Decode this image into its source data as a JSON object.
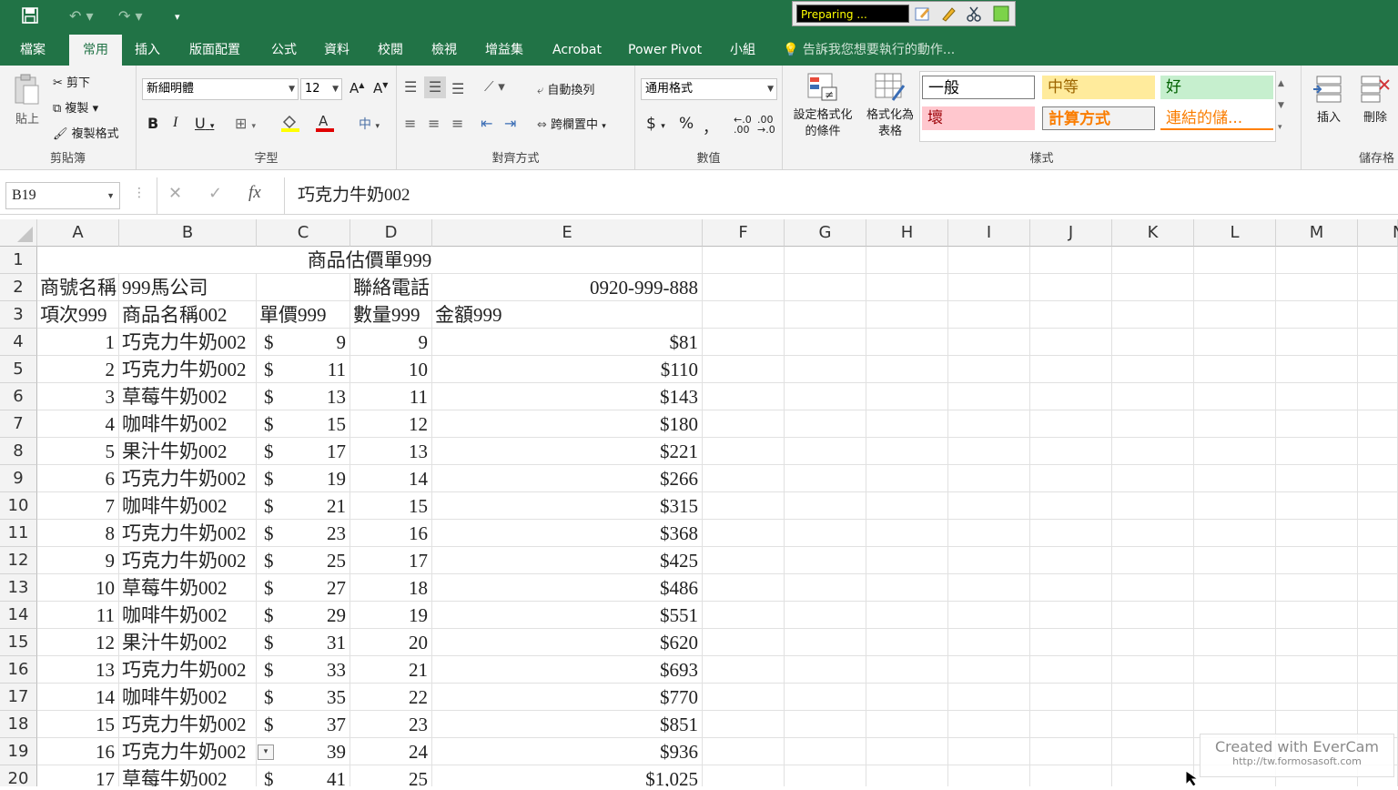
{
  "title_bar": {
    "recording_status": "Preparing ...",
    "record_icons": [
      "edit-icon",
      "pencil-icon",
      "scissors-icon",
      "stop-icon"
    ]
  },
  "tabs": [
    "檔案",
    "常用",
    "插入",
    "版面配置",
    "公式",
    "資料",
    "校閱",
    "檢視",
    "增益集",
    "Acrobat",
    "Power Pivot",
    "小組"
  ],
  "active_tab": "常用",
  "tell_me": "告訴我您想要執行的動作...",
  "ribbon": {
    "clipboard": {
      "paste": "貼上",
      "cut": "剪下",
      "copy": "複製",
      "format_painter": "複製格式",
      "label": "剪貼簿"
    },
    "font": {
      "name": "新細明體",
      "size": "12",
      "bold": "B",
      "italic": "I",
      "underline": "U",
      "label": "字型"
    },
    "alignment": {
      "wrap_text": "自動換列",
      "merge_center": "跨欄置中",
      "label": "對齊方式"
    },
    "number": {
      "format": "通用格式",
      "currency": "$",
      "percent": "%",
      "comma": "，",
      "label": "數值"
    },
    "styles": {
      "conditional": "設定格式化的條件",
      "format_as_table": "格式化為表格",
      "cells": [
        "一般",
        "中等",
        "好",
        "壞",
        "計算方式",
        "連結的儲..."
      ],
      "label": "樣式"
    },
    "cells_group": {
      "insert": "插入",
      "delete": "刪除",
      "label": "儲存格"
    }
  },
  "formula_bar": {
    "name_box": "B19",
    "cancel": "✕",
    "enter": "✓",
    "fx": "fx",
    "content": "巧克力牛奶002"
  },
  "columns": [
    "A",
    "B",
    "C",
    "D",
    "E",
    "F",
    "G",
    "H",
    "I",
    "J",
    "K",
    "L",
    "M",
    "N"
  ],
  "sheet": {
    "title": "商品估價單999",
    "row2": {
      "a": "商號名稱",
      "b": "999馬公司",
      "d": "聯絡電話",
      "e": "0920-999-888"
    },
    "row3": {
      "a": "項次999",
      "b": "商品名稱002",
      "c": "單價999",
      "d": "數量999",
      "e": "金額999"
    },
    "items": [
      {
        "row": "4",
        "no": "1",
        "name": "巧克力牛奶002",
        "cur": "$",
        "price": "9",
        "qty": "9",
        "amount": "$81"
      },
      {
        "row": "5",
        "no": "2",
        "name": "巧克力牛奶002",
        "cur": "$",
        "price": "11",
        "qty": "10",
        "amount": "$110"
      },
      {
        "row": "6",
        "no": "3",
        "name": "草莓牛奶002",
        "cur": "$",
        "price": "13",
        "qty": "11",
        "amount": "$143"
      },
      {
        "row": "7",
        "no": "4",
        "name": "咖啡牛奶002",
        "cur": "$",
        "price": "15",
        "qty": "12",
        "amount": "$180"
      },
      {
        "row": "8",
        "no": "5",
        "name": "果汁牛奶002",
        "cur": "$",
        "price": "17",
        "qty": "13",
        "amount": "$221"
      },
      {
        "row": "9",
        "no": "6",
        "name": "巧克力牛奶002",
        "cur": "$",
        "price": "19",
        "qty": "14",
        "amount": "$266"
      },
      {
        "row": "10",
        "no": "7",
        "name": "咖啡牛奶002",
        "cur": "$",
        "price": "21",
        "qty": "15",
        "amount": "$315"
      },
      {
        "row": "11",
        "no": "8",
        "name": "巧克力牛奶002",
        "cur": "$",
        "price": "23",
        "qty": "16",
        "amount": "$368"
      },
      {
        "row": "12",
        "no": "9",
        "name": "巧克力牛奶002",
        "cur": "$",
        "price": "25",
        "qty": "17",
        "amount": "$425"
      },
      {
        "row": "13",
        "no": "10",
        "name": "草莓牛奶002",
        "cur": "$",
        "price": "27",
        "qty": "18",
        "amount": "$486"
      },
      {
        "row": "14",
        "no": "11",
        "name": "咖啡牛奶002",
        "cur": "$",
        "price": "29",
        "qty": "19",
        "amount": "$551"
      },
      {
        "row": "15",
        "no": "12",
        "name": "果汁牛奶002",
        "cur": "$",
        "price": "31",
        "qty": "20",
        "amount": "$620"
      },
      {
        "row": "16",
        "no": "13",
        "name": "巧克力牛奶002",
        "cur": "$",
        "price": "33",
        "qty": "21",
        "amount": "$693"
      },
      {
        "row": "17",
        "no": "14",
        "name": "咖啡牛奶002",
        "cur": "$",
        "price": "35",
        "qty": "22",
        "amount": "$770"
      },
      {
        "row": "18",
        "no": "15",
        "name": "巧克力牛奶002",
        "cur": "$",
        "price": "37",
        "qty": "23",
        "amount": "$851"
      },
      {
        "row": "19",
        "no": "16",
        "name": "巧克力牛奶002",
        "cur": "",
        "price": "39",
        "qty": "24",
        "amount": "$936"
      },
      {
        "row": "20",
        "no": "17",
        "name": "草莓牛奶002",
        "cur": "$",
        "price": "41",
        "qty": "25",
        "amount": "$1,025"
      }
    ]
  },
  "watermark": {
    "line1": "Created with EverCam",
    "line2": "http://tw.formosasoft.com"
  },
  "colors": {
    "excel_green": "#217346",
    "ribbon_bg": "#f3f3f3"
  }
}
